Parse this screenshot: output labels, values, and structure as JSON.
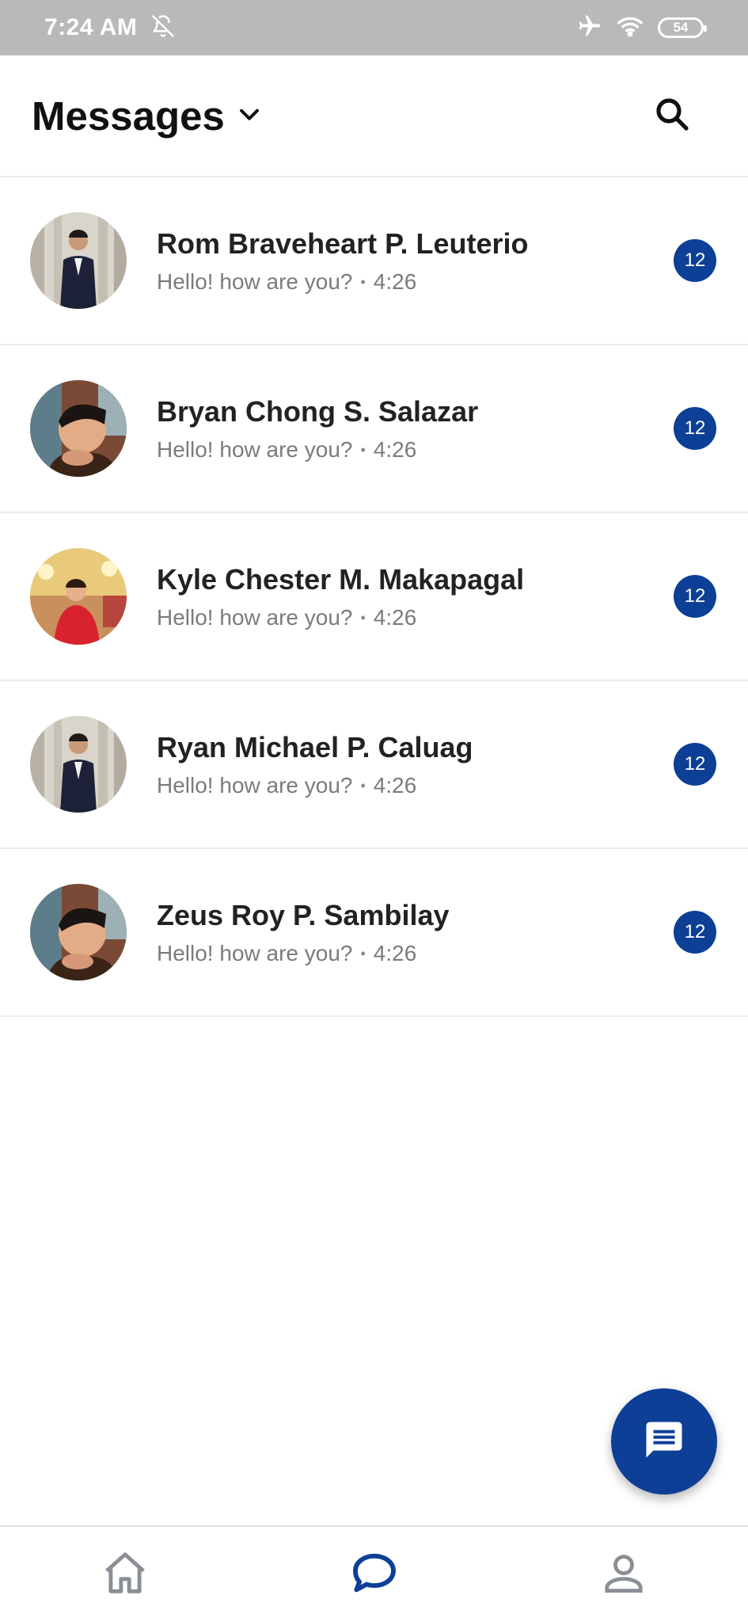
{
  "status_bar": {
    "time": "7:24 AM",
    "icons": [
      "bell-off-icon",
      "airplane-icon",
      "wifi-icon"
    ],
    "battery_level": "54"
  },
  "header": {
    "title": "Messages",
    "dropdown_icon": "chevron-down-icon",
    "search_icon": "search-icon"
  },
  "conversations": [
    {
      "name": "Rom Braveheart P. Leuterio",
      "preview": "Hello! how are you?",
      "time": "4:26",
      "unread": "12"
    },
    {
      "name": "Bryan Chong S. Salazar",
      "preview": "Hello! how are you?",
      "time": "4:26",
      "unread": "12"
    },
    {
      "name": "Kyle Chester M. Makapagal",
      "preview": "Hello! how are you?",
      "time": "4:26",
      "unread": "12"
    },
    {
      "name": "Ryan Michael P. Caluag",
      "preview": "Hello! how are you?",
      "time": "4:26",
      "unread": "12"
    },
    {
      "name": "Zeus Roy P. Sambilay",
      "preview": "Hello! how are you?",
      "time": "4:26",
      "unread": "12"
    }
  ],
  "fab": {
    "icon": "message-icon"
  },
  "bottom_nav": {
    "items": [
      {
        "icon": "home-icon",
        "active": false
      },
      {
        "icon": "chat-icon",
        "active": true
      },
      {
        "icon": "profile-icon",
        "active": false
      }
    ]
  },
  "colors": {
    "accent": "#0d3f96",
    "status_bar": "#b9b9b9",
    "nav_inactive": "#8a8f96",
    "divider": "#ececec"
  }
}
